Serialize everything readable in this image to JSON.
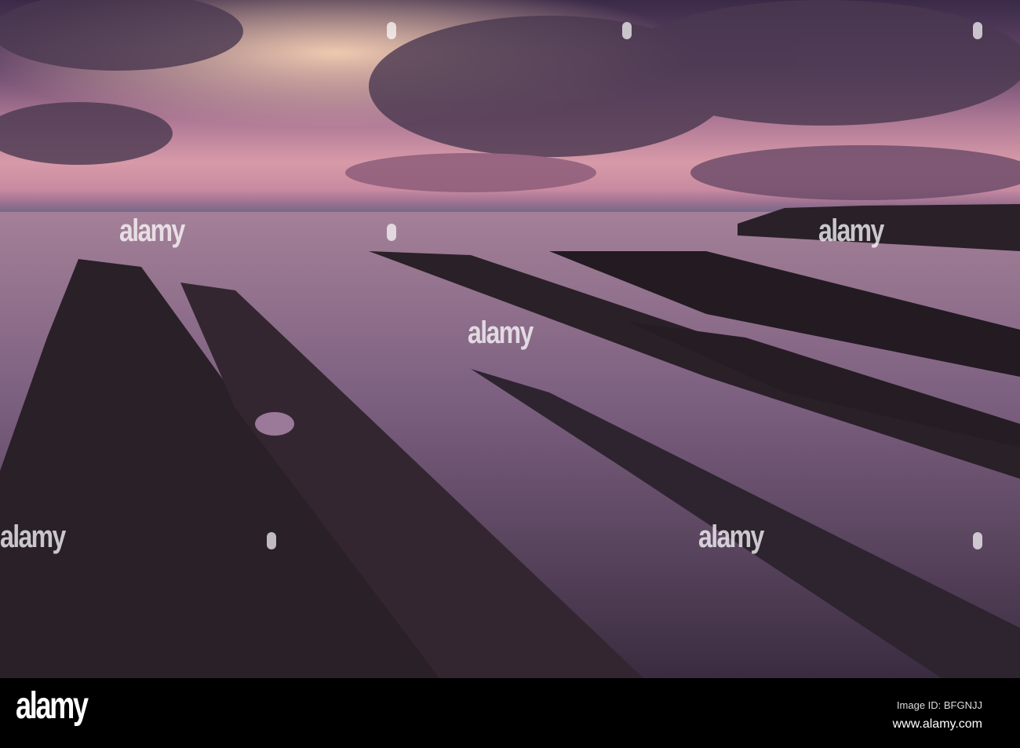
{
  "photo": {
    "subject": "rocky shore at sunset",
    "watermark_text": "alamy",
    "colors": {
      "sky_glow": "#d79aa8",
      "mist": "#8a6c8c",
      "rock": "#2a2028"
    }
  },
  "footer": {
    "logo": "alamy",
    "image_id": "Image ID: BFGNJJ",
    "url": "www.alamy.com"
  }
}
